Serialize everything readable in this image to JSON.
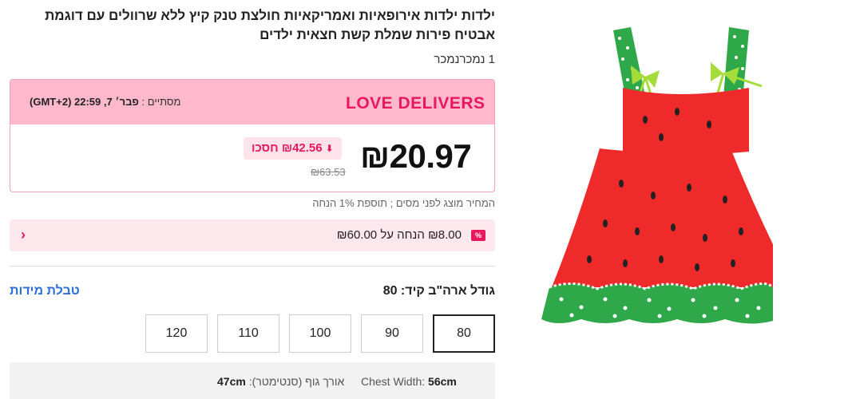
{
  "product": {
    "title": "ילדות ילדות אירופאיות ואמריקאיות חולצת טנק קיץ ללא שרוולים עם דוגמת אבטיח פירות שמלת קשת חצאית ילדים",
    "sold": "1 נמכרנמכר"
  },
  "promo": {
    "brand": "LOVE DELIVERS",
    "ends_label": "מסתיים :",
    "ends_value": "פבר׳ 7, 22:59 (GMT+2)",
    "price": "₪20.97",
    "save": "₪42.56 חסכו",
    "old_price": "₪63.53",
    "brand_color": "#e8185f",
    "header_bg": "#ffb8cc"
  },
  "tax_note": "המחיר מוצג לפני מסים ; תוספת 1% הנחה",
  "coupon": {
    "tag": "%",
    "text": "₪8.00 הנחה על ₪60.00",
    "chevron": "‹"
  },
  "size": {
    "label": "גודל ארה\"ב קיד: 80",
    "chart_link": "טבלת מידות",
    "options": [
      "80",
      "90",
      "100",
      "110",
      "120"
    ],
    "selected": "80"
  },
  "measurements": {
    "chest_label": "Chest Width:",
    "chest_value": "56cm",
    "length_label": "אורך גוף (סנטימטר):",
    "length_value": "47cm"
  }
}
